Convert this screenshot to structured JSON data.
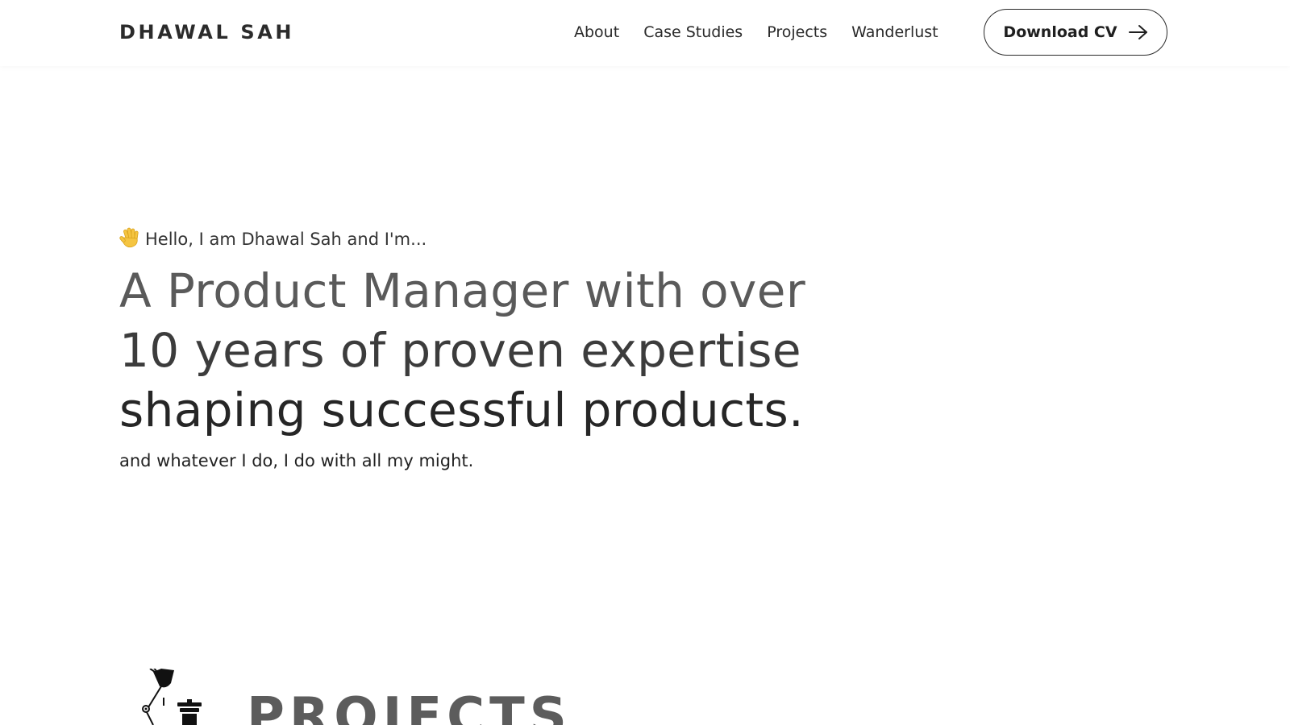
{
  "header": {
    "logo": "DHAWAL SAH",
    "nav": [
      {
        "label": "About"
      },
      {
        "label": "Case Studies"
      },
      {
        "label": "Projects"
      },
      {
        "label": "Wanderlust"
      }
    ],
    "cta": {
      "label": "Download CV",
      "icon": "arrow-right-icon"
    }
  },
  "hero": {
    "greeting_icon": "👋",
    "greeting": "Hello, I am Dhawal Sah and I'm...",
    "headline": [
      "A Product Manager with over",
      "10 years of proven expertise",
      "shaping successful products."
    ],
    "subline": "and whatever I do, I do with all my might."
  },
  "projects": {
    "title": "PROJECTS",
    "icon": "desk-lamp-icon"
  },
  "colors": {
    "background": "#ffffff",
    "text": "#222222",
    "headline_light": "#5a5a5a",
    "headline_dark": "#262626"
  }
}
